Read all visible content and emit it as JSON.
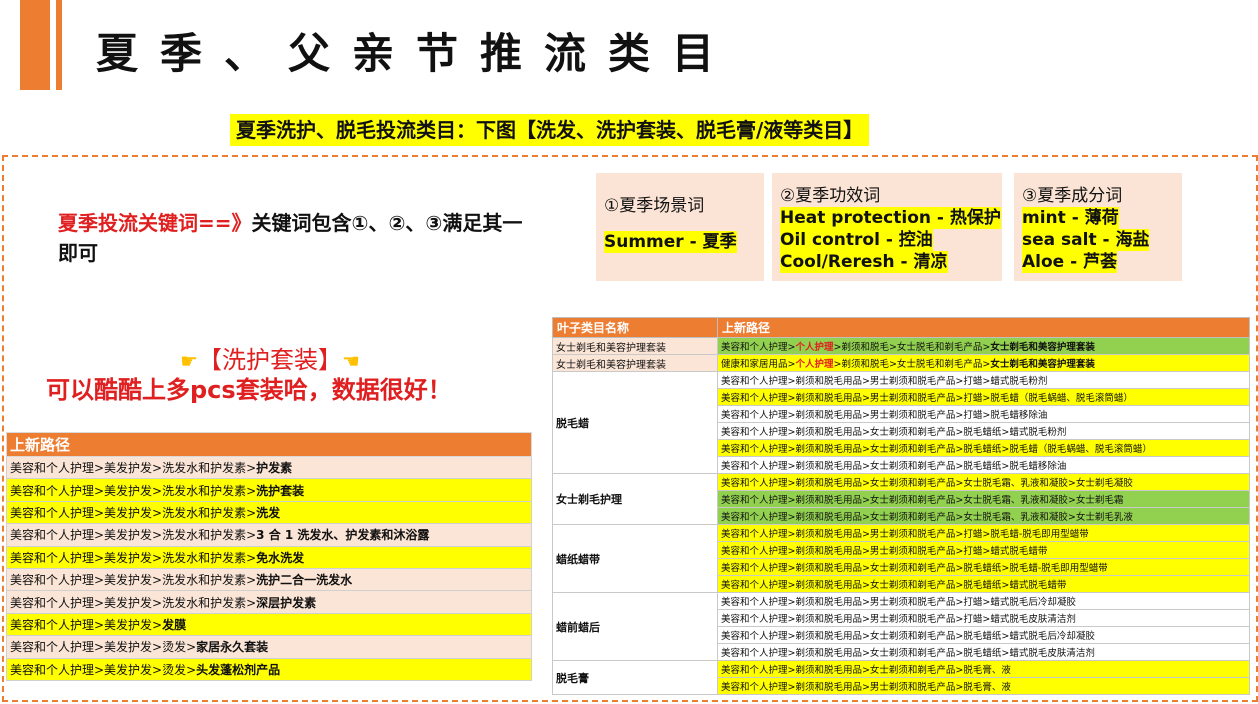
{
  "header": {
    "title": "夏季、父亲节推流类目"
  },
  "subtitle": "夏季洗护、脱毛投流类目：下图【洗发、洗护套装、脱毛膏/液等类目】",
  "keywords": {
    "label": "夏季投流关键词==》",
    "text": "关键词包含①、②、③满足其一即可"
  },
  "cards": [
    {
      "title": "①夏季场景词",
      "items": [
        "Summer - 夏季"
      ]
    },
    {
      "title": "②夏季功效词",
      "items": [
        "Heat protection - 热保护",
        "Oil control - 控油",
        "Cool/Reresh - 清凉"
      ]
    },
    {
      "title": "③夏季成分词",
      "items": [
        "mint - 薄荷",
        "sea salt - 海盐",
        "Aloe - 芦荟"
      ]
    }
  ],
  "promo": {
    "line1": "【洗护套装】",
    "line2": "可以酷酷上多pcs套装哈，数据很好！"
  },
  "left_table": {
    "header": "上新路径",
    "rows": [
      {
        "prefix": "美容和个人护理>美发护发>洗发水和护发素>",
        "leaf": "护发素",
        "bg": "cream"
      },
      {
        "prefix": "美容和个人护理>美发护发>洗发水和护发素>",
        "leaf": "洗护套装",
        "bg": "yellow"
      },
      {
        "prefix": "美容和个人护理>美发护发>洗发水和护发素>",
        "leaf": "洗发",
        "bg": "yellow"
      },
      {
        "prefix": "美容和个人护理>美发护发>洗发水和护发素>",
        "leaf": "3 合 1 洗发水、护发素和沐浴露",
        "bg": "cream"
      },
      {
        "prefix": "美容和个人护理>美发护发>洗发水和护发素>",
        "leaf": "免水洗发",
        "bg": "yellow"
      },
      {
        "prefix": "美容和个人护理>美发护发>洗发水和护发素>",
        "leaf": "洗护二合一洗发水",
        "bg": "cream"
      },
      {
        "prefix": "美容和个人护理>美发护发>洗发水和护发素>",
        "leaf": "深层护发素",
        "bg": "cream"
      },
      {
        "prefix": "美容和个人护理>美发护发>",
        "leaf": "发膜",
        "bg": "yellow"
      },
      {
        "prefix": "美容和个人护理>美发护发>烫发>",
        "leaf": "家居永久套装",
        "bg": "cream"
      },
      {
        "prefix": "美容和个人护理>美发护发>烫发>",
        "leaf": "头发蓬松剂产品",
        "bg": "yellow"
      }
    ]
  },
  "right_table": {
    "headers": [
      "叶子类目名称",
      "上新路径"
    ],
    "top_rows": [
      {
        "cat": "女士剃毛和美容护理套装",
        "p1": "美容和个人护理>",
        "red": "个人护理",
        "p2": ">剃须和脱毛>女士脱毛和剃毛产品>",
        "leaf": "女士剃毛和美容护理套装",
        "bg": "green"
      },
      {
        "cat": "女士剃毛和美容护理套装",
        "p1": "健康和家居用品>",
        "red": "个人护理",
        "p2": ">剃须和脱毛>女士脱毛和剃毛产品>",
        "leaf": "女士剃毛和美容护理套装",
        "bg": "yellow"
      }
    ],
    "groups": [
      {
        "cat": "脱毛蜡",
        "rows": [
          {
            "text": "美容和个人护理>剃须和脱毛用品>男士剃须和脱毛产品>打蜡>蜡式脱毛粉剂",
            "bg": "white"
          },
          {
            "text": "美容和个人护理>剃须和脱毛用品>男士剃须和脱毛产品>打蜡>脱毛蜡（脱毛蜗蜡、脱毛滚筒蜡）",
            "bg": "yellow"
          },
          {
            "text": "美容和个人护理>剃须和脱毛用品>男士剃须和脱毛产品>打蜡>脱毛蜡移除油",
            "bg": "white"
          },
          {
            "text": "美容和个人护理>剃须和脱毛用品>女士剃须和剃毛产品>脱毛蜡纸>蜡式脱毛粉剂",
            "bg": "white"
          },
          {
            "text": "美容和个人护理>剃须和脱毛用品>女士剃须和剃毛产品>脱毛蜡纸>脱毛蜡（脱毛蜗蜡、脱毛滚筒蜡）",
            "bg": "yellow"
          },
          {
            "text": "美容和个人护理>剃须和脱毛用品>女士剃须和剃毛产品>脱毛蜡纸>脱毛蜡移除油",
            "bg": "white"
          }
        ]
      },
      {
        "cat": "女士剃毛护理",
        "rows": [
          {
            "text": "美容和个人护理>剃须和脱毛用品>女士剃须和剃毛产品>女士脱毛霜、乳液和凝胶>女士剃毛凝胶",
            "bg": "yellow"
          },
          {
            "text": "美容和个人护理>剃须和脱毛用品>女士剃须和剃毛产品>女士脱毛霜、乳液和凝胶>女士剃毛霜",
            "bg": "green"
          },
          {
            "text": "美容和个人护理>剃须和脱毛用品>女士剃须和剃毛产品>女士脱毛霜、乳液和凝胶>女士剃毛乳液",
            "bg": "green"
          }
        ]
      },
      {
        "cat": "蜡纸蜡带",
        "rows": [
          {
            "text": "美容和个人护理>剃须和脱毛用品>男士剃须和脱毛产品>打蜡>脱毛蜡-脱毛即用型蜡带",
            "bg": "yellow"
          },
          {
            "text": "美容和个人护理>剃须和脱毛用品>男士剃须和脱毛产品>打蜡>蜡式脱毛蜡带",
            "bg": "yellow"
          },
          {
            "text": "美容和个人护理>剃须和脱毛用品>女士剃须和剃毛产品>脱毛蜡纸>脱毛蜡-脱毛即用型蜡带",
            "bg": "yellow"
          },
          {
            "text": "美容和个人护理>剃须和脱毛用品>女士剃须和剃毛产品>脱毛蜡纸>蜡式脱毛蜡带",
            "bg": "yellow"
          }
        ]
      },
      {
        "cat": "蜡前蜡后",
        "rows": [
          {
            "text": "美容和个人护理>剃须和脱毛用品>男士剃须和脱毛产品>打蜡>蜡式脱毛后冷却凝胶",
            "bg": "white"
          },
          {
            "text": "美容和个人护理>剃须和脱毛用品>男士剃须和脱毛产品>打蜡>蜡式脱毛皮肤清洁剂",
            "bg": "white"
          },
          {
            "text": "美容和个人护理>剃须和脱毛用品>女士剃须和剃毛产品>脱毛蜡纸>蜡式脱毛后冷却凝胶",
            "bg": "white"
          },
          {
            "text": "美容和个人护理>剃须和脱毛用品>女士剃须和剃毛产品>脱毛蜡纸>蜡式脱毛皮肤清洁剂",
            "bg": "white"
          }
        ]
      },
      {
        "cat": "脱毛膏",
        "rows": [
          {
            "text": "美容和个人护理>剃须和脱毛用品>女士剃须和剃毛产品>脱毛膏、液",
            "bg": "yellow"
          },
          {
            "text": "美容和个人护理>剃须和脱毛用品>男士剃须和脱毛产品>脱毛膏、液",
            "bg": "yellow"
          }
        ]
      }
    ]
  },
  "colors": {
    "accent": "#ED7D31",
    "highlight": "#FFFF00",
    "card": "#FBE4D5",
    "green": "#92D050",
    "red": "#E02020"
  }
}
